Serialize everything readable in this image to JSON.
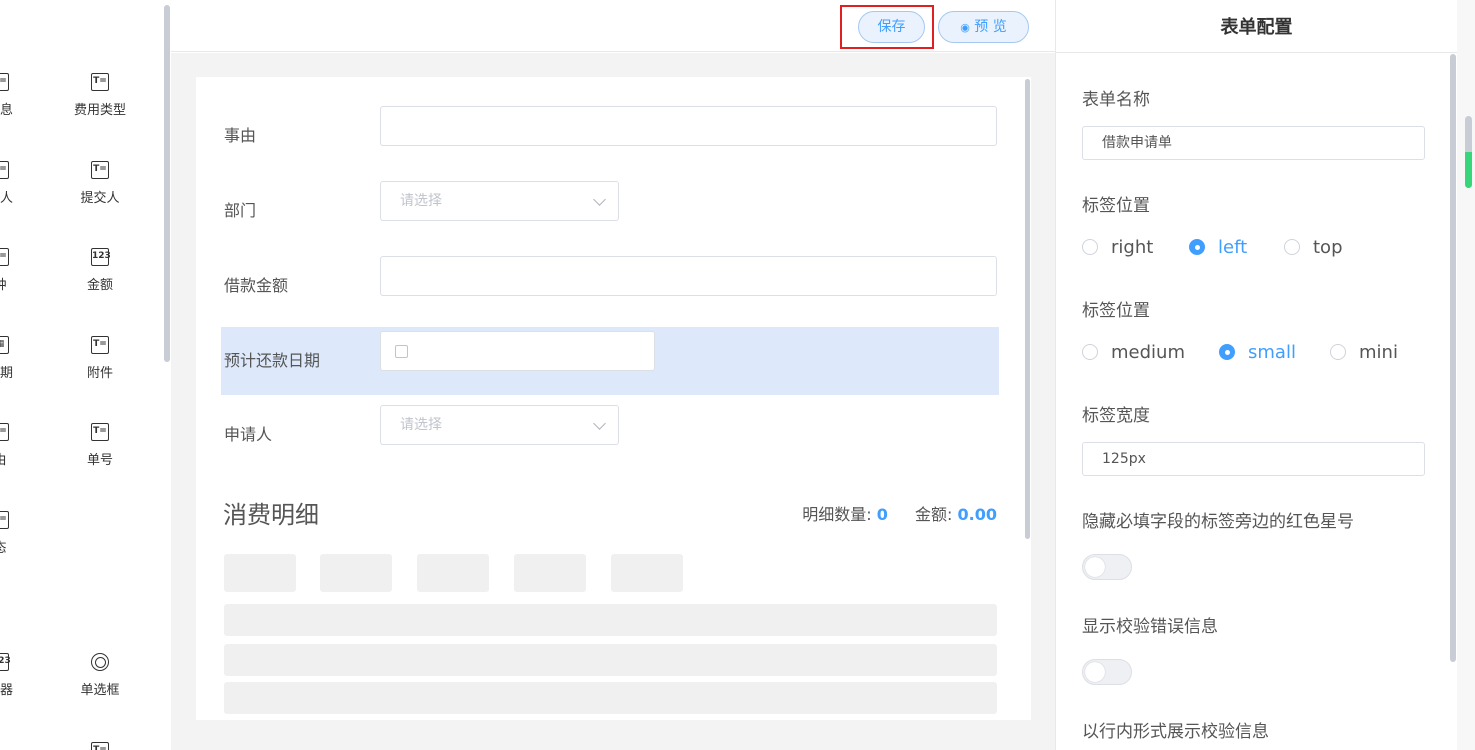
{
  "left_panel": {
    "components": [
      {
        "label": "信息",
        "icon": "text-field-icon"
      },
      {
        "label": "费用类型",
        "icon": "text-field-icon"
      },
      {
        "label": "请人",
        "icon": "text-field-icon"
      },
      {
        "label": "提交人",
        "icon": "text-field-icon"
      },
      {
        "label": "种",
        "icon": "text-field-icon"
      },
      {
        "label": "金额",
        "icon": "number-field-icon"
      },
      {
        "label": "日期",
        "icon": "date-field-icon"
      },
      {
        "label": "附件",
        "icon": "text-field-icon"
      },
      {
        "label": "由",
        "icon": "text-field-icon"
      },
      {
        "label": "单号",
        "icon": "text-field-icon"
      },
      {
        "label": "态",
        "icon": "text-field-icon"
      },
      {
        "label": "数器",
        "icon": "number-field-icon"
      },
      {
        "label": "单选框",
        "icon": "radio-icon"
      }
    ]
  },
  "toolbar": {
    "save_label": "保存",
    "preview_label": "预 览"
  },
  "form": {
    "fields": [
      {
        "label": "事由",
        "type": "text",
        "value": ""
      },
      {
        "label": "部门",
        "type": "select",
        "placeholder": "请选择"
      },
      {
        "label": "借款金额",
        "type": "text",
        "value": ""
      },
      {
        "label": "预计还款日期",
        "type": "date",
        "value": ""
      },
      {
        "label": "申请人",
        "type": "select",
        "placeholder": "请选择"
      }
    ],
    "section": {
      "title": "消费明细",
      "count_label": "明细数量:",
      "count_value": "0",
      "amount_label": "金额:",
      "amount_value": "0.00"
    }
  },
  "config": {
    "title": "表单配置",
    "form_name_label": "表单名称",
    "form_name_value": "借款申请单",
    "label_position_label": "标签位置",
    "label_position_options": [
      "right",
      "left",
      "top"
    ],
    "label_position_selected": "left",
    "size_label": "标签位置",
    "size_options": [
      "medium",
      "small",
      "mini"
    ],
    "size_selected": "small",
    "label_width_label": "标签宽度",
    "label_width_value": "125px",
    "hide_required_label": "隐藏必填字段的标签旁边的红色星号",
    "hide_required_on": false,
    "show_error_label": "显示校验错误信息",
    "show_error_on": false,
    "inline_error_label": "以行内形式展示校验信息"
  },
  "colors": {
    "accent": "#409eff",
    "highlight_border": "#e02020",
    "active_row": "#dde9fb"
  }
}
